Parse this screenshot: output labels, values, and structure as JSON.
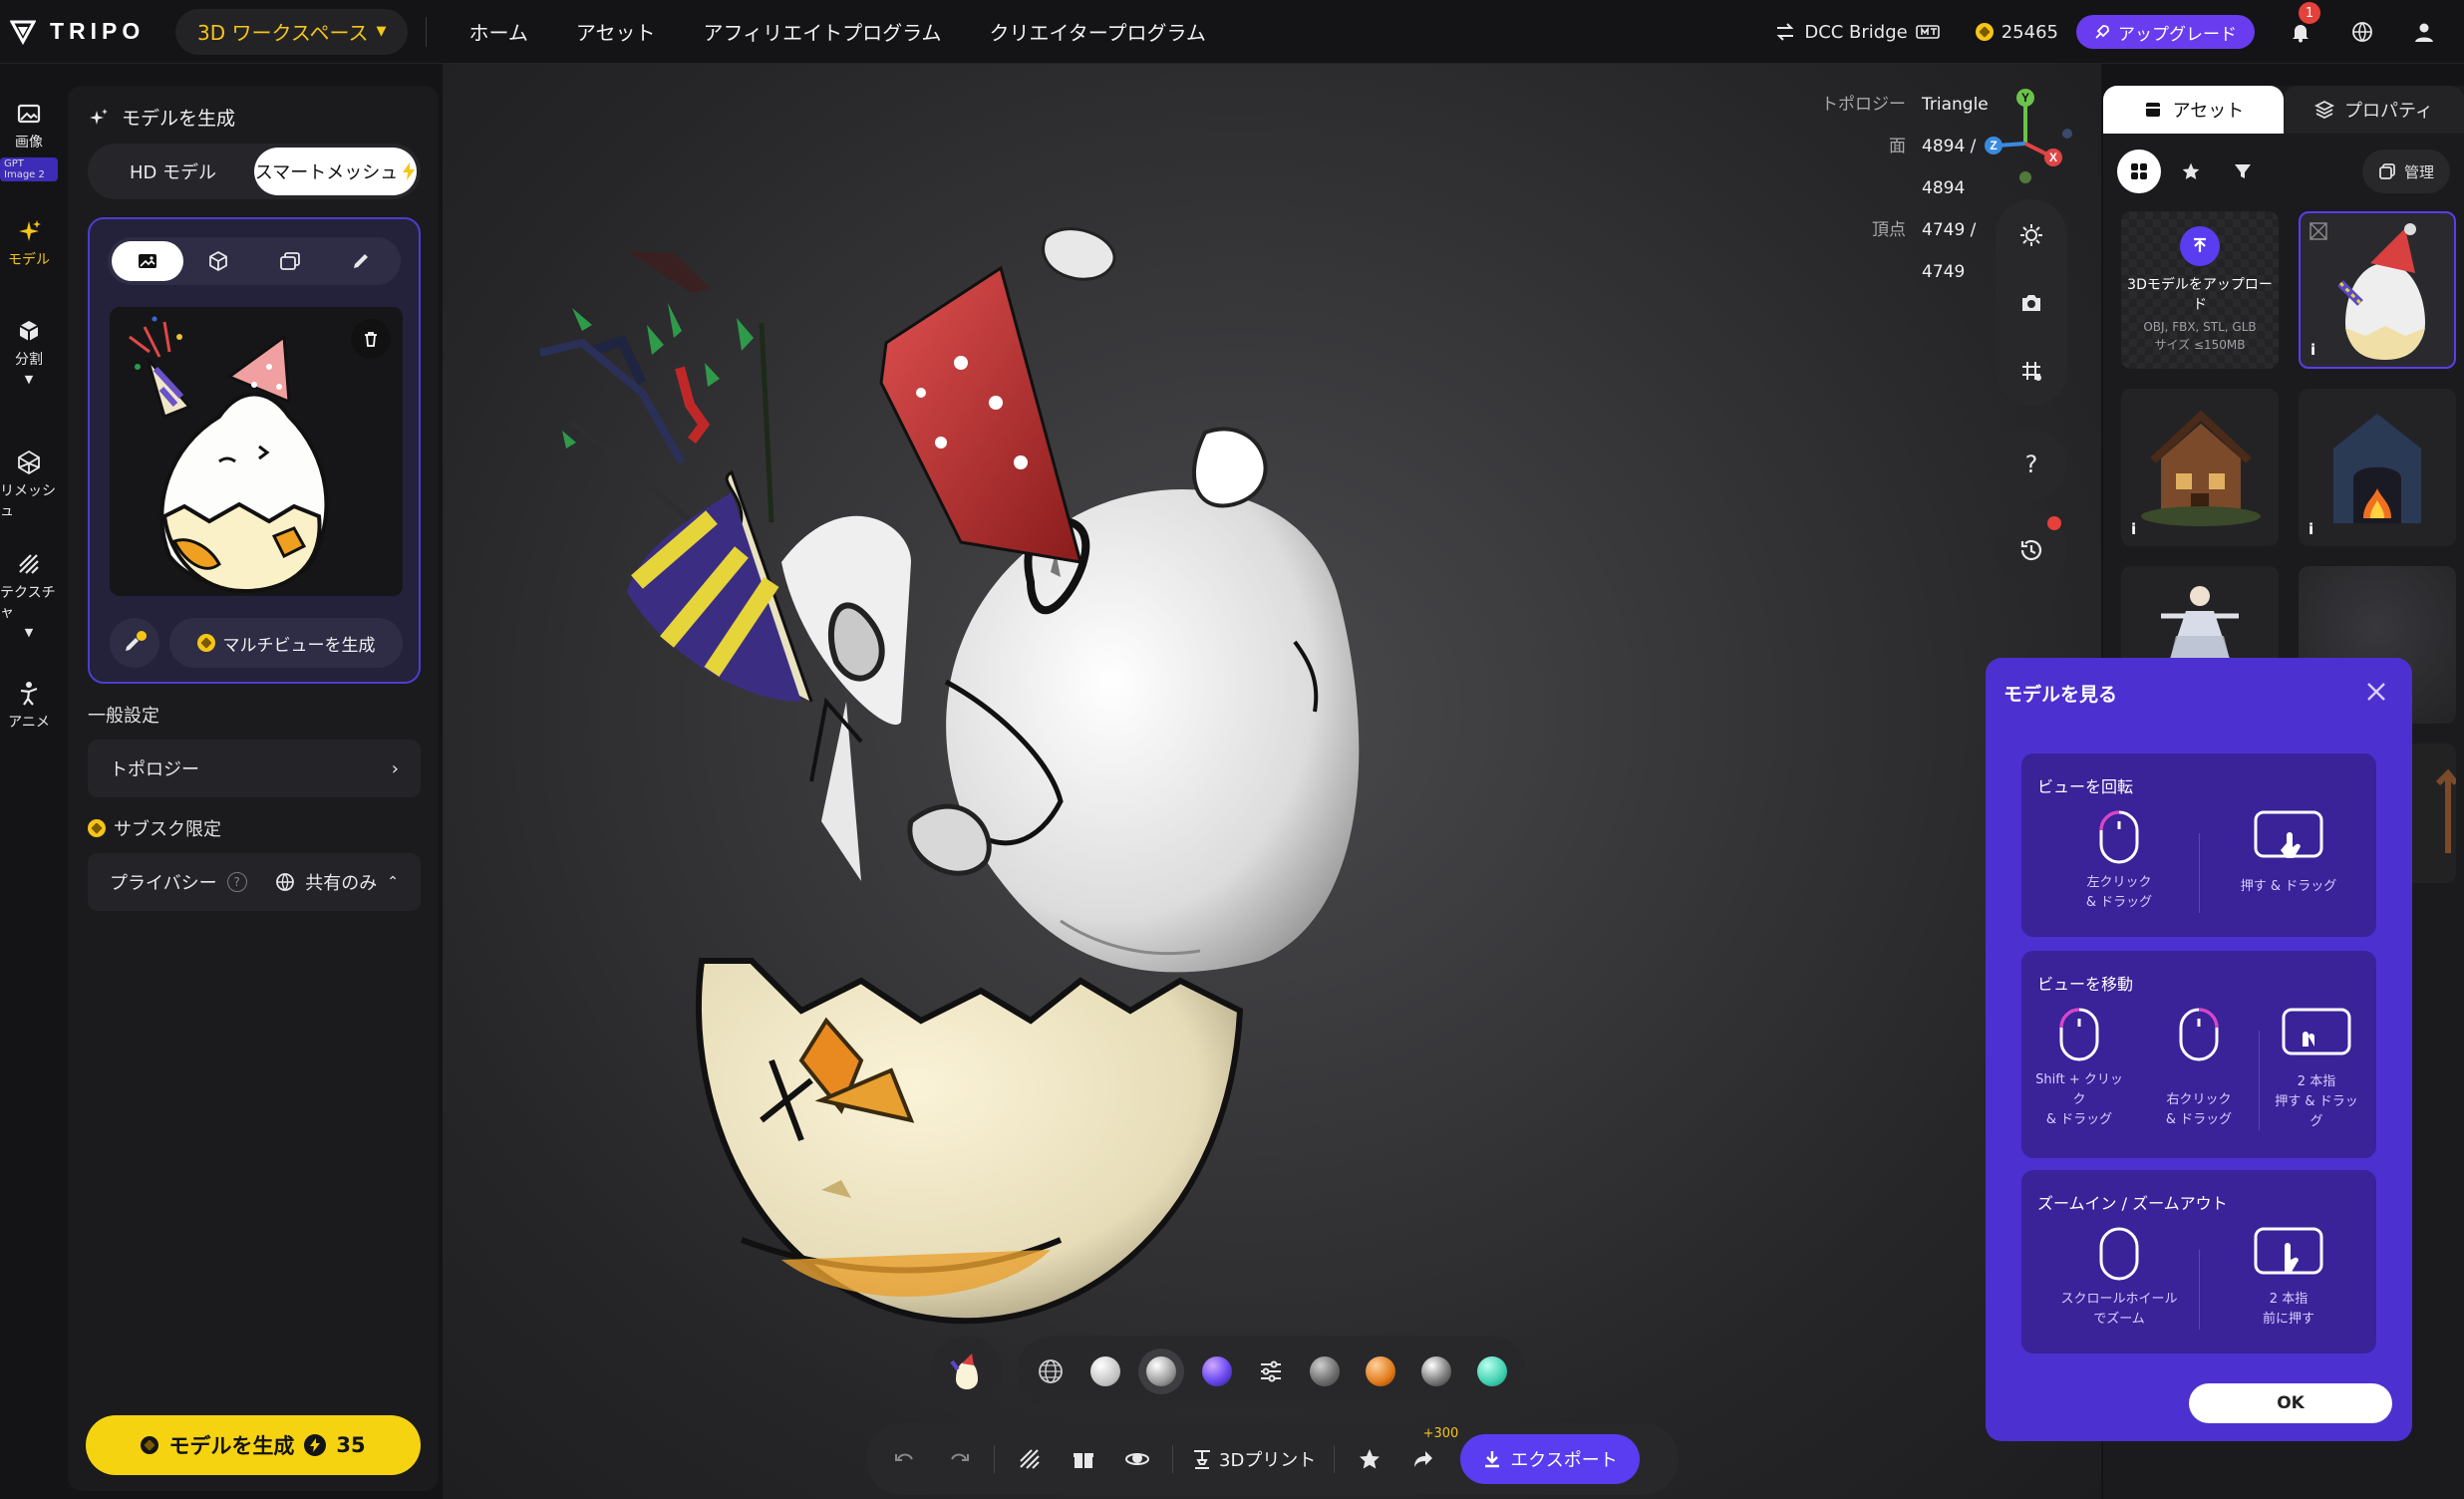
{
  "header": {
    "logo_text": "TRIPO",
    "workspace_label": "3D ワークスペース",
    "nav": [
      "ホーム",
      "アセット",
      "アフィリエイトプログラム",
      "クリエイタープログラム"
    ],
    "dcc_label": "DCC Bridge",
    "credits": "25465",
    "upgrade_label": "アップグレード",
    "notification_count": "1",
    "accent_color": "#f5c518",
    "brand_purple": "#5a3df0"
  },
  "rail": [
    {
      "label": "画像",
      "icon": "image-icon",
      "badge": "GPT Image 2"
    },
    {
      "label": "モデル",
      "icon": "sparkle-icon",
      "active": true
    },
    {
      "label": "分割",
      "icon": "cube-split-icon"
    },
    {
      "label": "リメッシュ",
      "icon": "remesh-icon"
    },
    {
      "label": "テクスチャ",
      "icon": "texture-icon"
    },
    {
      "label": "アニメ",
      "icon": "figure-icon"
    }
  ],
  "left_panel": {
    "title": "モデルを生成",
    "mode_tabs": [
      "HD モデル",
      "スマートメッシュ"
    ],
    "multiview_label": "マルチビューを生成",
    "general_label": "一般設定",
    "topology_label": "トポロジー",
    "subs_label": "サブスク限定",
    "privacy_label": "プライバシー",
    "privacy_value": "共有のみ",
    "generate_label": "モデルを生成",
    "generate_cost": "35"
  },
  "viewport": {
    "stats": [
      {
        "label": "トポロジー",
        "value": "Triangle"
      },
      {
        "label": "面",
        "value": "4894 / 4894"
      },
      {
        "label": "頂点",
        "value": "4749 / 4749"
      }
    ],
    "axes": {
      "y": "Y",
      "z": "Z",
      "x": "X"
    },
    "help_label": "?",
    "print_label": "3Dプリント",
    "share_bonus": "+300",
    "export_label": "エクスポート"
  },
  "right_panel": {
    "tabs": [
      "アセット",
      "プロパティ"
    ],
    "manage_label": "管理",
    "upload_title": "3Dモデルをアップロード",
    "upload_formats": "OBJ, FBX, STL, GLB",
    "upload_size": "サイズ ≤150MB"
  },
  "modal": {
    "title": "モデルを見る",
    "sections": [
      {
        "title": "ビューを回転",
        "items": [
          {
            "line1": "左クリック",
            "line2": "& ドラッグ"
          },
          {
            "line1": "押す & ドラッグ",
            "line2": ""
          }
        ]
      },
      {
        "title": "ビューを移動",
        "items": [
          {
            "line1": "Shift + クリッ",
            "line2": "ク",
            "line3": "& ドラッグ"
          },
          {
            "line1": "右クリック",
            "line2": "& ドラッグ"
          },
          {
            "line1": "2 本指",
            "line2": "押す & ドラッ",
            "line3": "グ"
          }
        ]
      },
      {
        "title": "ズームイン / ズームアウト",
        "items": [
          {
            "line1": "スクロールホイール",
            "line2": "でズーム"
          },
          {
            "line1": "2 本指",
            "line2": "前に押す"
          }
        ]
      }
    ],
    "ok_label": "OK"
  }
}
